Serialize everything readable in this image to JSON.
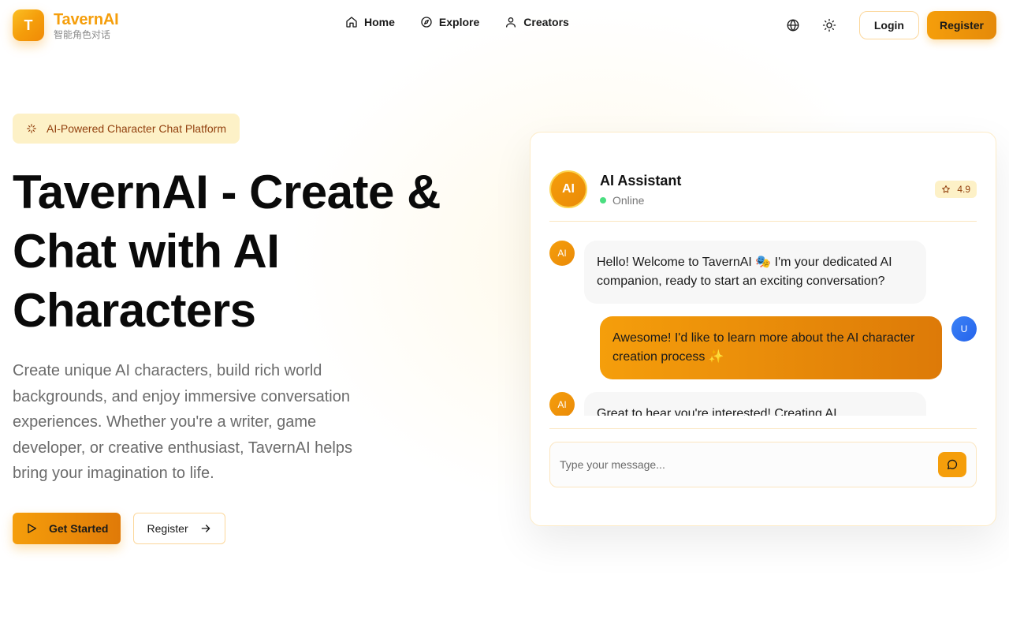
{
  "brand": {
    "logo_letter": "T",
    "name": "TavernAI",
    "subtitle": "智能角色对话",
    "accent_color": "#f59e0b"
  },
  "nav": {
    "items": [
      {
        "label": "Home",
        "icon": "home-icon"
      },
      {
        "label": "Explore",
        "icon": "compass-icon"
      },
      {
        "label": "Creators",
        "icon": "user-icon"
      }
    ]
  },
  "header_actions": {
    "language_icon": "globe-icon",
    "theme_icon": "sun-icon",
    "login_label": "Login",
    "register_label": "Register"
  },
  "hero": {
    "badge": "AI-Powered Character Chat Platform",
    "title": "TavernAI - Create & Chat with AI Characters",
    "description": "Create unique AI characters, build rich world backgrounds, and enjoy immersive conversation experiences. Whether you're a writer, game developer, or creative enthusiast, TavernAI helps bring your imagination to life.",
    "primary_cta": "Get Started",
    "secondary_cta": "Register"
  },
  "chat_preview": {
    "assistant_avatar": "AI",
    "assistant_name": "AI Assistant",
    "status": "Online",
    "rating": "4.9",
    "messages": [
      {
        "sender": "AI",
        "role": "ai",
        "text": "Hello! Welcome to TavernAI 🎭 I'm your dedicated AI companion, ready to start an exciting conversation?"
      },
      {
        "sender": "U",
        "role": "user",
        "text": "Awesome! I'd like to learn more about the AI character creation process ✨"
      },
      {
        "sender": "AI",
        "role": "ai",
        "text": "Great to hear you're interested! Creating AI"
      }
    ],
    "input_placeholder": "Type your message..."
  }
}
